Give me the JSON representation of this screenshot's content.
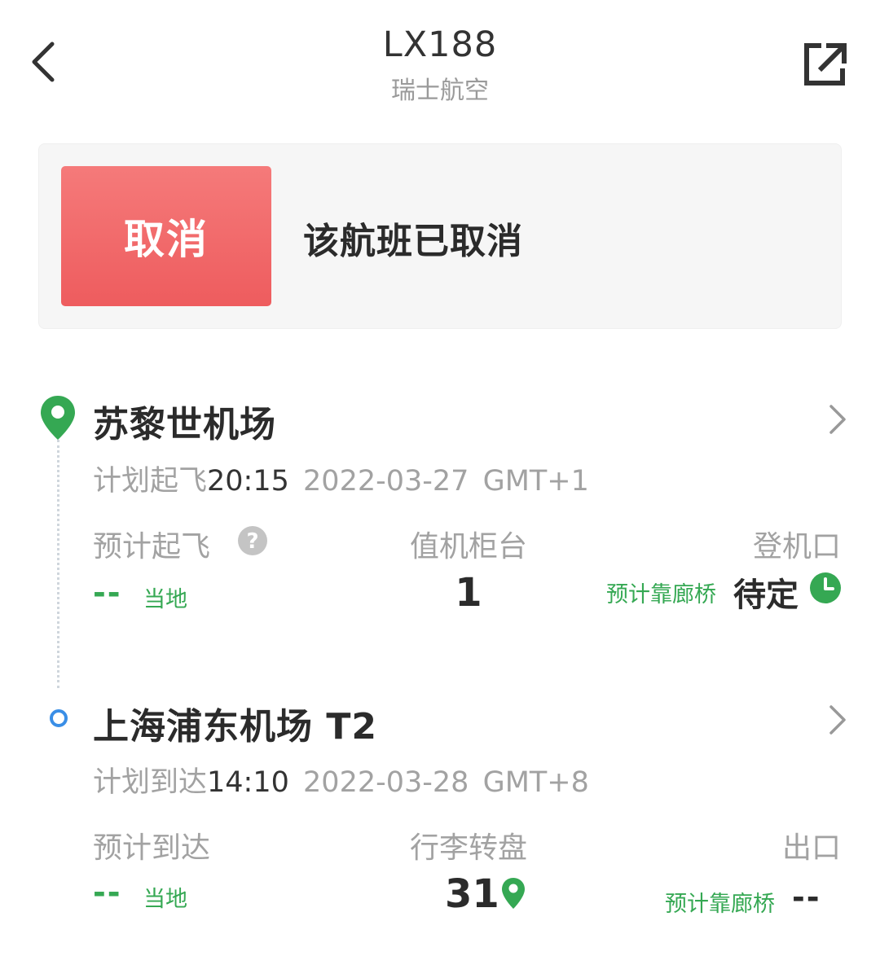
{
  "header": {
    "flight_number": "LX188",
    "airline": "瑞士航空",
    "back_icon": "chevron-left-icon",
    "share_icon": "share-external-icon"
  },
  "status": {
    "badge": "取消",
    "message": "该航班已取消",
    "badge_color": "#ef6466"
  },
  "departure": {
    "airport": "苏黎世机场",
    "scheduled_label": "计划起飞",
    "scheduled_time": "20:15",
    "scheduled_date": "2022-03-27",
    "timezone": "GMT+1",
    "estimated_label": "预计起飞",
    "estimated_value": "--",
    "estimated_note": "当地",
    "counter_label": "值机柜台",
    "counter_value": "1",
    "gate_label": "登机口",
    "gate_note": "预计靠廊桥",
    "gate_value": "待定"
  },
  "arrival": {
    "airport": "上海浦东机场 T2",
    "scheduled_label": "计划到达",
    "scheduled_time": "14:10",
    "scheduled_date": "2022-03-28",
    "timezone": "GMT+8",
    "estimated_label": "预计到达",
    "estimated_value": "--",
    "estimated_note": "当地",
    "baggage_label": "行李转盘",
    "baggage_value": "31",
    "exit_label": "出口",
    "exit_note": "预计靠廊桥",
    "exit_value": "--"
  },
  "colors": {
    "accent_green": "#35a853",
    "arrival_dot": "#3a8ee6",
    "text_dark": "#2b2b2b",
    "text_muted": "#a2a2a2"
  }
}
